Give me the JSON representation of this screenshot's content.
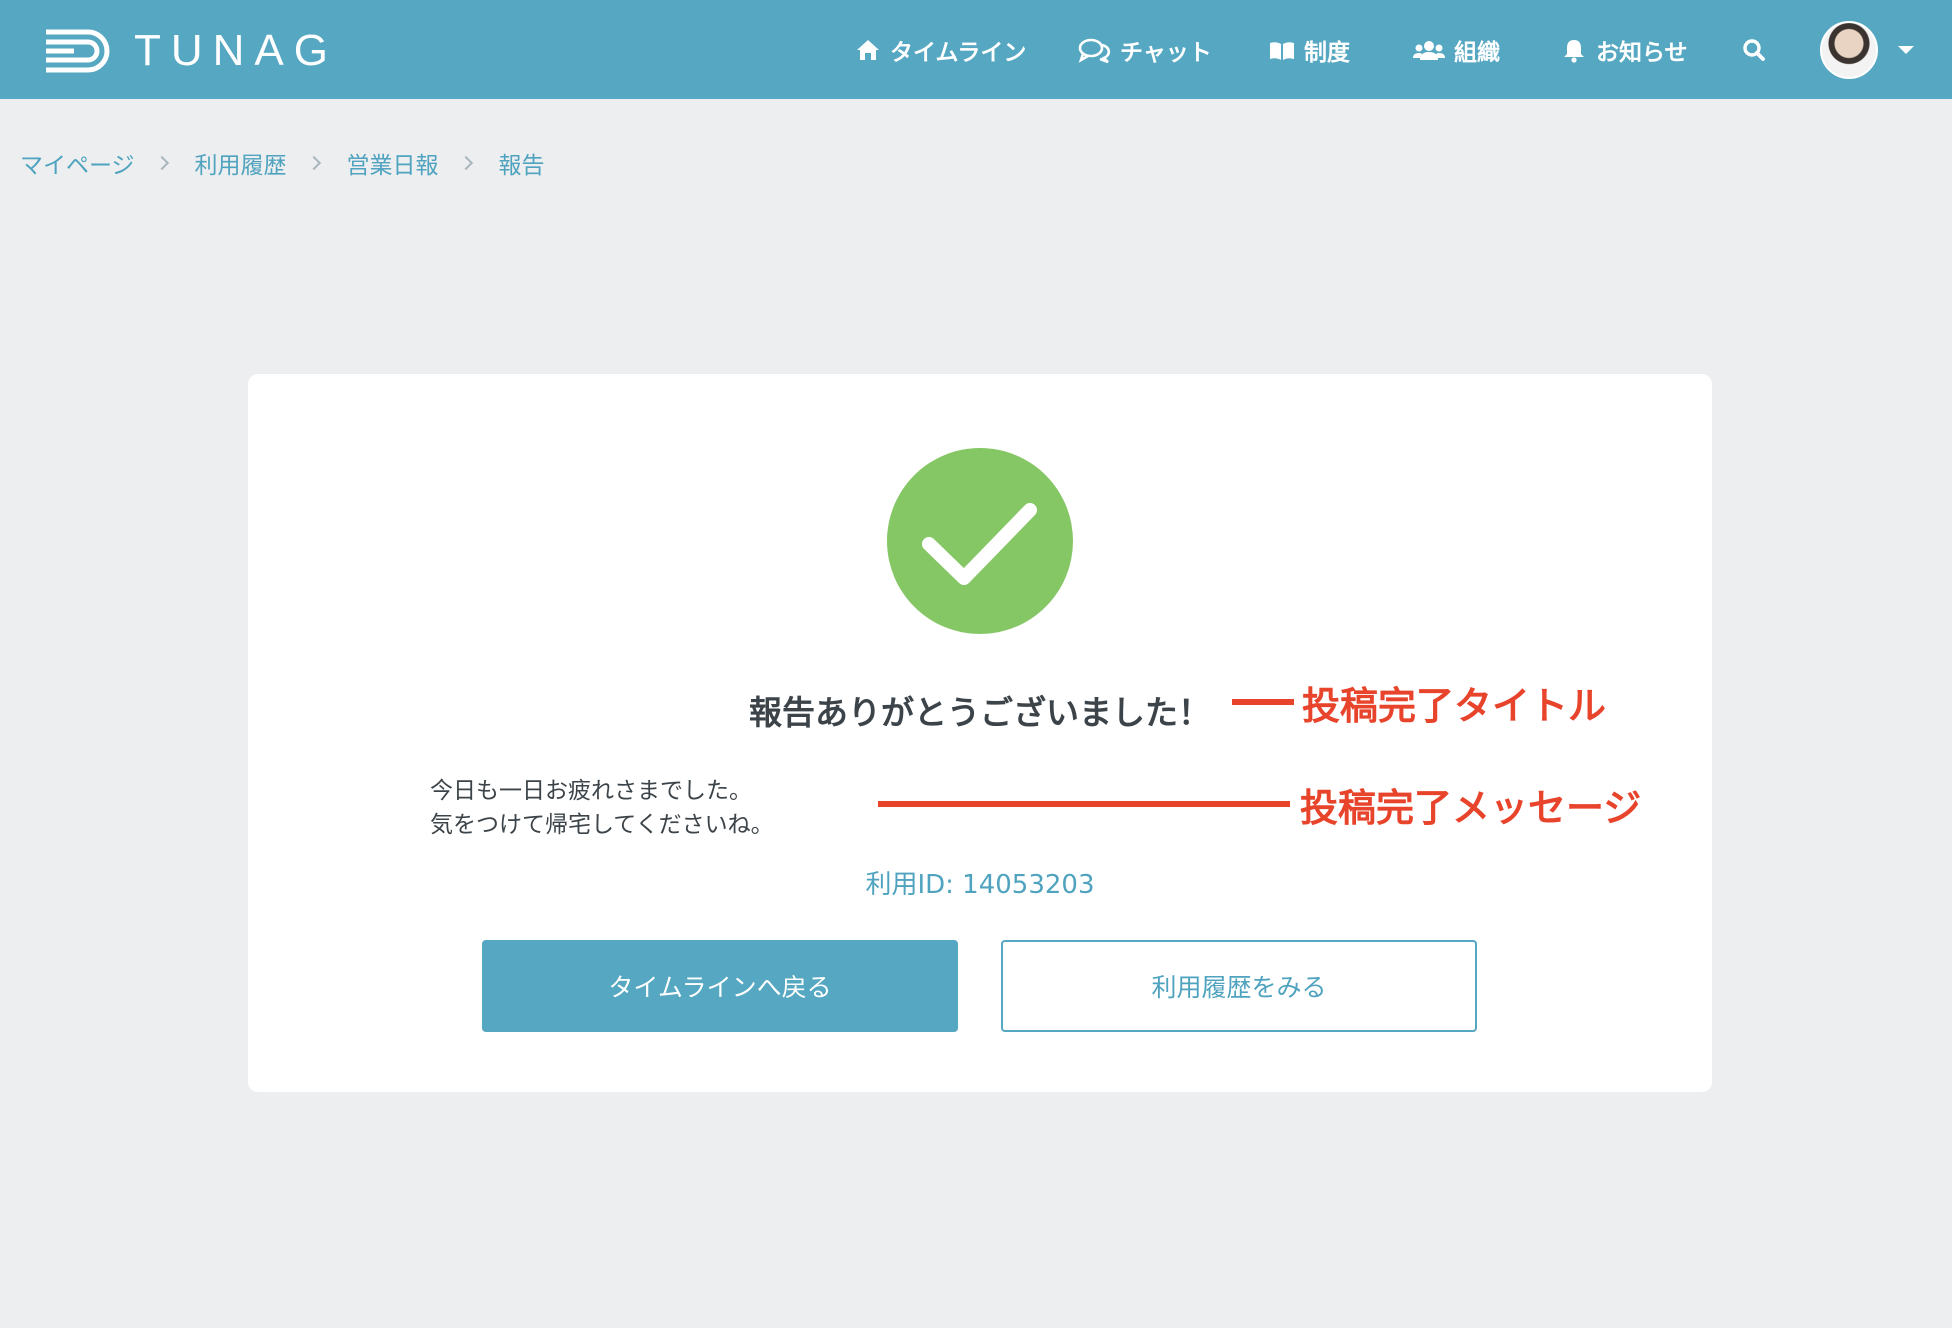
{
  "app": {
    "logo_text": "TUNAG"
  },
  "nav": {
    "timeline": "タイムライン",
    "chat": "チャット",
    "system": "制度",
    "organization": "組織",
    "notice": "お知らせ"
  },
  "breadcrumb": {
    "items": [
      "マイページ",
      "利用履歴",
      "営業日報",
      "報告"
    ]
  },
  "card": {
    "title": "報告ありがとうございました！",
    "message_lines": [
      "今日も一日お疲れさまでした。",
      "気をつけて帰宅してくださいね。"
    ],
    "usage_id": "利用ID:  14053203",
    "primary_button": "タイムラインへ戻る",
    "secondary_button": "利用履歴をみる"
  },
  "annotations": {
    "title_label": "投稿完了タイトル",
    "message_label": "投稿完了メッセージ"
  },
  "colors": {
    "header": "#55a7c2",
    "background": "#eceef0",
    "accent_text": "#4fa3bf",
    "success": "#86c765",
    "annotation": "#e8442c"
  },
  "icons": [
    "home-icon",
    "chat-icon",
    "book-icon",
    "users-icon",
    "bell-icon",
    "search-icon",
    "check-icon",
    "chevron-right-icon",
    "caret-down-icon"
  ]
}
